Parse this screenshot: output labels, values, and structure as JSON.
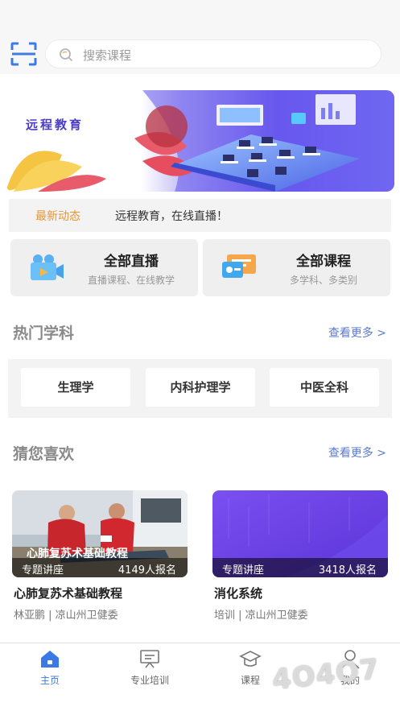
{
  "search": {
    "placeholder": "搜索课程"
  },
  "banner": {
    "title": "远程教育"
  },
  "news": {
    "tag": "最新动态",
    "text": "远程教育，在线直播！"
  },
  "entries": [
    {
      "title": "全部直播",
      "subtitle": "直播课程、在线教学",
      "icon": "video-camera-icon"
    },
    {
      "title": "全部课程",
      "subtitle": "多学科、多类别",
      "icon": "course-board-icon"
    }
  ],
  "hot": {
    "title": "热门学科",
    "more": "查看更多 >",
    "items": [
      "生理学",
      "内科护理学",
      "中医全科"
    ]
  },
  "guess": {
    "title": "猜您喜欢",
    "more": "查看更多 >",
    "cards": [
      {
        "overlay_title": "心肺复苏术基础教程",
        "tag": "专题讲座",
        "count": "4149人报名",
        "name": "心肺复苏术基础教程",
        "meta": "林亚鹏 | 凉山州卫健委"
      },
      {
        "overlay_title": "",
        "tag": "专题讲座",
        "count": "3418人报名",
        "name": "消化系统",
        "meta": "培训 | 凉山州卫健委"
      }
    ]
  },
  "tabs": [
    {
      "label": "主页",
      "icon": "home-icon",
      "active": true
    },
    {
      "label": "专业培训",
      "icon": "training-board-icon",
      "active": false
    },
    {
      "label": "课程",
      "icon": "graduation-cap-icon",
      "active": false
    },
    {
      "label": "我的",
      "icon": "user-icon",
      "active": false
    }
  ],
  "watermark": "4O4O7",
  "colors": {
    "accent": "#3b7ae6",
    "news_tag": "#e8963a",
    "more_link": "#5b7ad0"
  }
}
